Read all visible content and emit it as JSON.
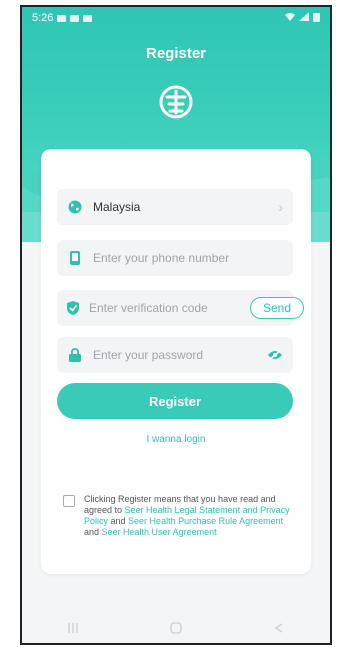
{
  "status_bar": {
    "time": "5:26"
  },
  "header": {
    "title": "Register"
  },
  "form": {
    "country": {
      "value": "Malaysia"
    },
    "phone": {
      "placeholder": "Enter your phone number"
    },
    "code": {
      "placeholder": "Enter verification code",
      "send_label": "Send"
    },
    "password": {
      "placeholder": "Enter your password"
    },
    "register_label": "Register",
    "login_link": "I wanna login"
  },
  "agreement": {
    "text_1": "Clicking Register means that you have read and agreed to ",
    "link_1": "Seer Health Legal Statement and Privacy Policy",
    "text_2": " and ",
    "link_2": "Seer Health Purchase Rule Agreement",
    "text_3": " and ",
    "link_3": "Seer Health User Agreement"
  },
  "colors": {
    "accent": "#39cab8",
    "link": "#2fc1af"
  },
  "icons": [
    "globe-icon",
    "phone-icon",
    "shield-icon",
    "lock-icon",
    "eye-off-icon",
    "chevron-right-icon",
    "checkbox-icon",
    "app-logo-icon"
  ]
}
